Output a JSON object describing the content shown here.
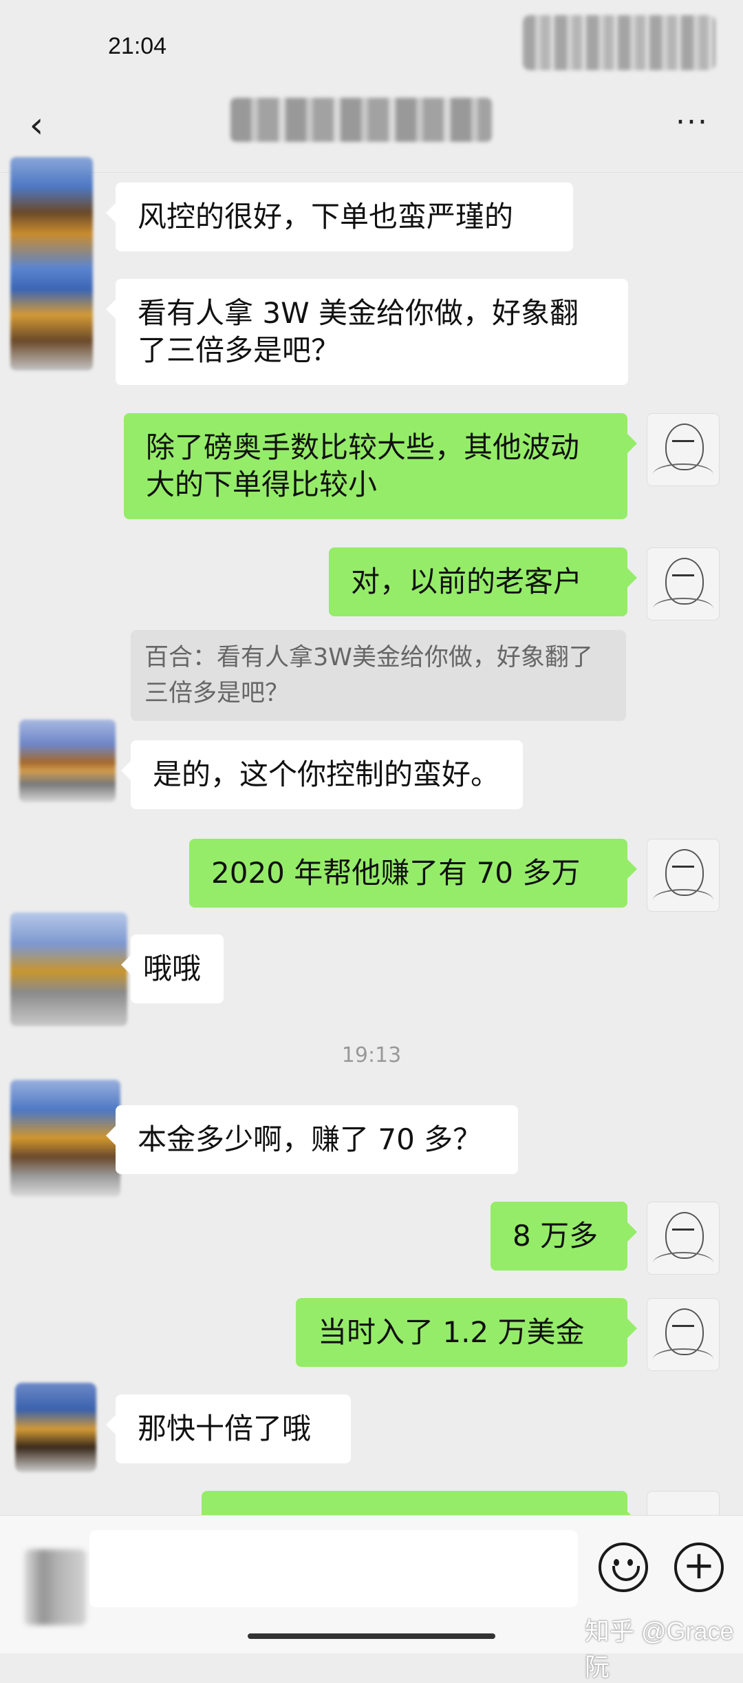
{
  "status_bar": {
    "time": "21:04"
  },
  "nav": {
    "back_icon": "chevron-left-icon",
    "back_glyph": "‹",
    "more_icon": "more-dots-icon",
    "more_glyph": "···"
  },
  "messages": [
    {
      "side": "in",
      "text": "风控的很好，下单也蛮严瑾的"
    },
    {
      "side": "in",
      "text": "看有人拿 3W 美金给你做，好象翻了三倍多是吧？"
    },
    {
      "side": "out",
      "text": "除了磅奥手数比较大些，其他波动大的下单得比较小"
    },
    {
      "side": "out",
      "text": "对，以前的老客户"
    },
    {
      "side": "in",
      "text": "是的，这个你控制的蛮好。"
    },
    {
      "side": "out",
      "text": "2020 年帮他赚了有 70 多万"
    },
    {
      "side": "in",
      "text": "哦哦"
    },
    {
      "side": "in",
      "text": "本金多少啊，赚了 70 多？"
    },
    {
      "side": "out",
      "text": "8 万多"
    },
    {
      "side": "out",
      "text": "当时入了 1.2 万美金"
    },
    {
      "side": "in",
      "text": "那快十倍了哦"
    }
  ],
  "quote": {
    "text": "百合：看有人拿3W美金给你做，好象翻了三倍多是吧？"
  },
  "timestamp": "19:13",
  "input_bar": {
    "emoji_icon": "smiley-icon",
    "plus_icon": "plus-circle-icon",
    "plus_glyph": "+"
  },
  "watermark": "知乎 @Grace阮",
  "colors": {
    "background": "#ededed",
    "out_bubble": "#95ec69",
    "in_bubble": "#ffffff"
  }
}
